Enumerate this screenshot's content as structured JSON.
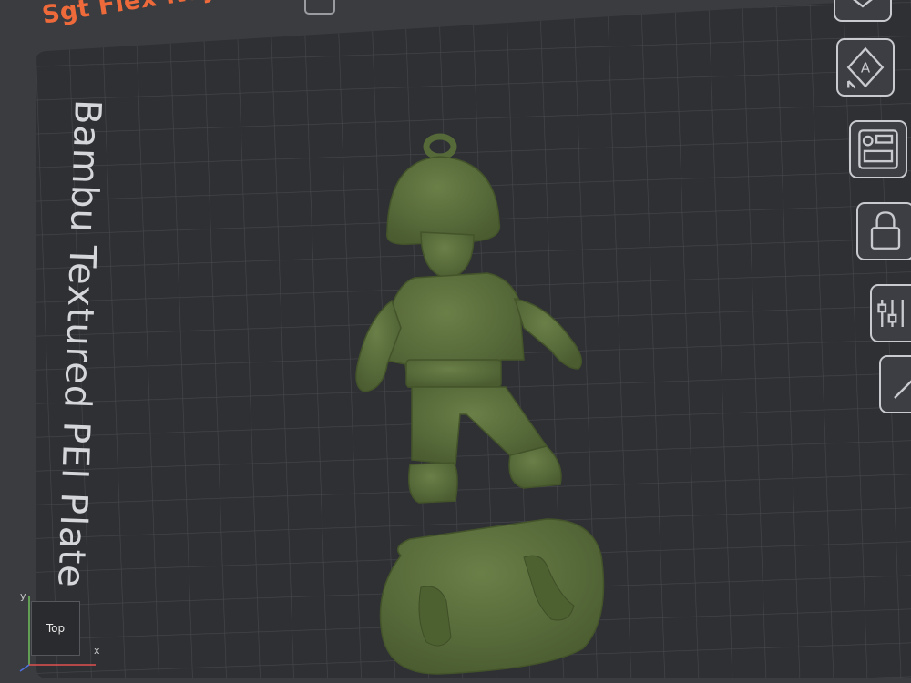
{
  "plate": {
    "title": "Sgt Flex Keychain",
    "name": "Bambu Textured PEI Plate"
  },
  "toolbar": {
    "tools": [
      {
        "icon": "arrange-icon"
      },
      {
        "icon": "auto-orient-icon",
        "letter": "A"
      },
      {
        "icon": "layout-icon"
      },
      {
        "icon": "lock-icon"
      },
      {
        "icon": "settings-icon"
      },
      {
        "icon": "edit-icon"
      }
    ]
  },
  "view_cube": {
    "face": "Top",
    "axis_x": "x",
    "axis_y": "y"
  },
  "colors": {
    "background": "#3a3c40",
    "plate": "#2f3034",
    "grid": "#45474c",
    "title": "#ef6a3a",
    "model": "#586c3c"
  },
  "models": [
    {
      "name": "soldier-figure"
    },
    {
      "name": "base-plate"
    }
  ]
}
